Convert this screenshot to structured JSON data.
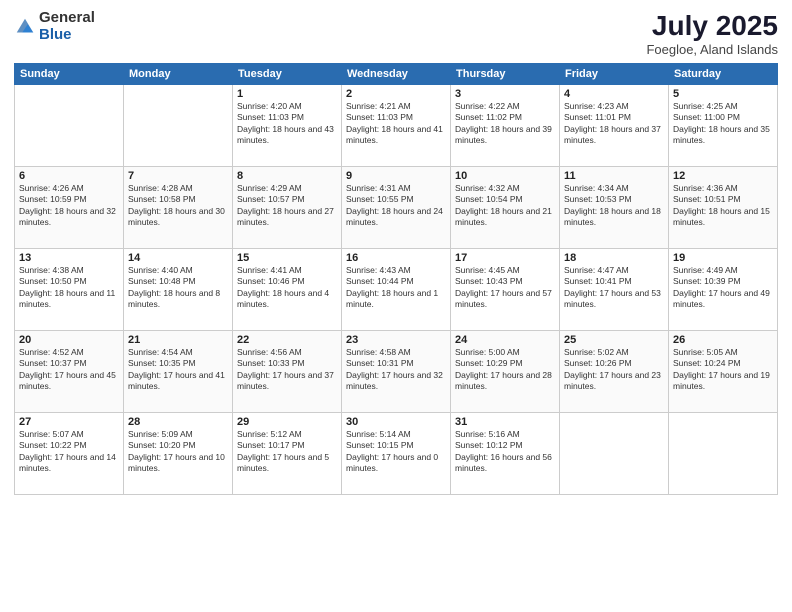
{
  "logo": {
    "general": "General",
    "blue": "Blue"
  },
  "title": "July 2025",
  "location": "Foegloe, Aland Islands",
  "weekdays": [
    "Sunday",
    "Monday",
    "Tuesday",
    "Wednesday",
    "Thursday",
    "Friday",
    "Saturday"
  ],
  "weeks": [
    [
      {
        "day": null
      },
      {
        "day": null
      },
      {
        "day": "1",
        "sunrise": "4:20 AM",
        "sunset": "11:03 PM",
        "daylight": "18 hours and 43 minutes."
      },
      {
        "day": "2",
        "sunrise": "4:21 AM",
        "sunset": "11:03 PM",
        "daylight": "18 hours and 41 minutes."
      },
      {
        "day": "3",
        "sunrise": "4:22 AM",
        "sunset": "11:02 PM",
        "daylight": "18 hours and 39 minutes."
      },
      {
        "day": "4",
        "sunrise": "4:23 AM",
        "sunset": "11:01 PM",
        "daylight": "18 hours and 37 minutes."
      },
      {
        "day": "5",
        "sunrise": "4:25 AM",
        "sunset": "11:00 PM",
        "daylight": "18 hours and 35 minutes."
      }
    ],
    [
      {
        "day": "6",
        "sunrise": "4:26 AM",
        "sunset": "10:59 PM",
        "daylight": "18 hours and 32 minutes."
      },
      {
        "day": "7",
        "sunrise": "4:28 AM",
        "sunset": "10:58 PM",
        "daylight": "18 hours and 30 minutes."
      },
      {
        "day": "8",
        "sunrise": "4:29 AM",
        "sunset": "10:57 PM",
        "daylight": "18 hours and 27 minutes."
      },
      {
        "day": "9",
        "sunrise": "4:31 AM",
        "sunset": "10:55 PM",
        "daylight": "18 hours and 24 minutes."
      },
      {
        "day": "10",
        "sunrise": "4:32 AM",
        "sunset": "10:54 PM",
        "daylight": "18 hours and 21 minutes."
      },
      {
        "day": "11",
        "sunrise": "4:34 AM",
        "sunset": "10:53 PM",
        "daylight": "18 hours and 18 minutes."
      },
      {
        "day": "12",
        "sunrise": "4:36 AM",
        "sunset": "10:51 PM",
        "daylight": "18 hours and 15 minutes."
      }
    ],
    [
      {
        "day": "13",
        "sunrise": "4:38 AM",
        "sunset": "10:50 PM",
        "daylight": "18 hours and 11 minutes."
      },
      {
        "day": "14",
        "sunrise": "4:40 AM",
        "sunset": "10:48 PM",
        "daylight": "18 hours and 8 minutes."
      },
      {
        "day": "15",
        "sunrise": "4:41 AM",
        "sunset": "10:46 PM",
        "daylight": "18 hours and 4 minutes."
      },
      {
        "day": "16",
        "sunrise": "4:43 AM",
        "sunset": "10:44 PM",
        "daylight": "18 hours and 1 minute."
      },
      {
        "day": "17",
        "sunrise": "4:45 AM",
        "sunset": "10:43 PM",
        "daylight": "17 hours and 57 minutes."
      },
      {
        "day": "18",
        "sunrise": "4:47 AM",
        "sunset": "10:41 PM",
        "daylight": "17 hours and 53 minutes."
      },
      {
        "day": "19",
        "sunrise": "4:49 AM",
        "sunset": "10:39 PM",
        "daylight": "17 hours and 49 minutes."
      }
    ],
    [
      {
        "day": "20",
        "sunrise": "4:52 AM",
        "sunset": "10:37 PM",
        "daylight": "17 hours and 45 minutes."
      },
      {
        "day": "21",
        "sunrise": "4:54 AM",
        "sunset": "10:35 PM",
        "daylight": "17 hours and 41 minutes."
      },
      {
        "day": "22",
        "sunrise": "4:56 AM",
        "sunset": "10:33 PM",
        "daylight": "17 hours and 37 minutes."
      },
      {
        "day": "23",
        "sunrise": "4:58 AM",
        "sunset": "10:31 PM",
        "daylight": "17 hours and 32 minutes."
      },
      {
        "day": "24",
        "sunrise": "5:00 AM",
        "sunset": "10:29 PM",
        "daylight": "17 hours and 28 minutes."
      },
      {
        "day": "25",
        "sunrise": "5:02 AM",
        "sunset": "10:26 PM",
        "daylight": "17 hours and 23 minutes."
      },
      {
        "day": "26",
        "sunrise": "5:05 AM",
        "sunset": "10:24 PM",
        "daylight": "17 hours and 19 minutes."
      }
    ],
    [
      {
        "day": "27",
        "sunrise": "5:07 AM",
        "sunset": "10:22 PM",
        "daylight": "17 hours and 14 minutes."
      },
      {
        "day": "28",
        "sunrise": "5:09 AM",
        "sunset": "10:20 PM",
        "daylight": "17 hours and 10 minutes."
      },
      {
        "day": "29",
        "sunrise": "5:12 AM",
        "sunset": "10:17 PM",
        "daylight": "17 hours and 5 minutes."
      },
      {
        "day": "30",
        "sunrise": "5:14 AM",
        "sunset": "10:15 PM",
        "daylight": "17 hours and 0 minutes."
      },
      {
        "day": "31",
        "sunrise": "5:16 AM",
        "sunset": "10:12 PM",
        "daylight": "16 hours and 56 minutes."
      },
      {
        "day": null
      },
      {
        "day": null
      }
    ]
  ]
}
